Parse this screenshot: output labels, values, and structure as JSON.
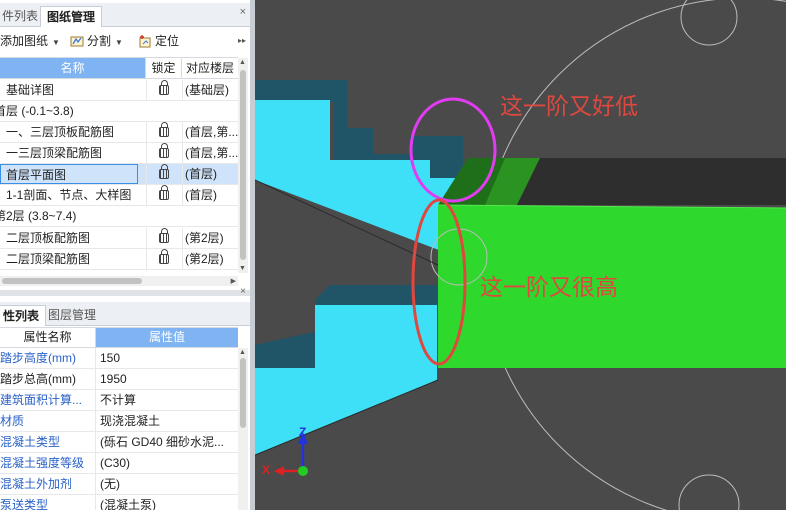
{
  "drawing_panel": {
    "tabs": [
      {
        "label": "件列表"
      },
      {
        "label": "图纸管理"
      }
    ],
    "close_glyph": "×",
    "toolbar": {
      "add_drawing": "添加图纸",
      "split": "分割",
      "locate": "定位",
      "more_glyph": "▸▸"
    },
    "columns": {
      "name": "名称",
      "lock": "锁定",
      "floor": "对应楼层"
    },
    "rows": [
      {
        "name": "基础详图",
        "floor": "(基础层)",
        "type": "item"
      },
      {
        "name": "首层 (-0.1~3.8)",
        "floor": "",
        "type": "group"
      },
      {
        "name": "一、三层顶板配筋图",
        "floor": "(首层,第...",
        "type": "item"
      },
      {
        "name": "一三层顶梁配筋图",
        "floor": "(首层,第...",
        "type": "item"
      },
      {
        "name": "首层平面图",
        "floor": "(首层)",
        "type": "item",
        "selected": true
      },
      {
        "name": "1-1剖面、节点、大样图",
        "floor": "(首层)",
        "type": "item"
      },
      {
        "name": "第2层 (3.8~7.4)",
        "floor": "",
        "type": "group"
      },
      {
        "name": "二层顶板配筋图",
        "floor": "(第2层)",
        "type": "item"
      },
      {
        "name": "二层顶梁配筋图",
        "floor": "(第2层)",
        "type": "item"
      }
    ]
  },
  "property_panel": {
    "tabs": [
      {
        "label": "性列表"
      },
      {
        "label": "图层管理"
      }
    ],
    "close_glyph": "×",
    "columns": {
      "name": "属性名称",
      "value": "属性值"
    },
    "rows": [
      {
        "name": "踏步高度(mm)",
        "value": "150",
        "blue": true
      },
      {
        "name": "踏步总高(mm)",
        "value": "1950",
        "blue": false
      },
      {
        "name": "建筑面积计算...",
        "value": "不计算",
        "blue": true
      },
      {
        "name": "材质",
        "value": "现浇混凝土",
        "blue": true
      },
      {
        "name": "混凝土类型",
        "value": "(砾石 GD40 细砂水泥...",
        "blue": true
      },
      {
        "name": "混凝土强度等级",
        "value": "(C30)",
        "blue": true
      },
      {
        "name": "混凝土外加剂",
        "value": "(无)",
        "blue": true
      },
      {
        "name": "泵送类型",
        "value": "(混凝土泵)",
        "blue": true
      }
    ]
  },
  "viewport": {
    "annotations": {
      "top": "这一阶又好低",
      "bottom": "这一阶又很高"
    },
    "axis": {
      "x": "X",
      "z": "Z"
    },
    "colors": {
      "background": "#4a4a4a",
      "stair_cyan": "#3ee0f8",
      "stair_edge": "#1f5566",
      "slab_green": "#2ed82c",
      "slab_top": "#1e6e1a",
      "magenta": "#e23cf2",
      "red": "#e0473f",
      "axis_blue": "#2233dd",
      "axis_red": "#e02020",
      "axis_green": "#22cc22"
    }
  }
}
